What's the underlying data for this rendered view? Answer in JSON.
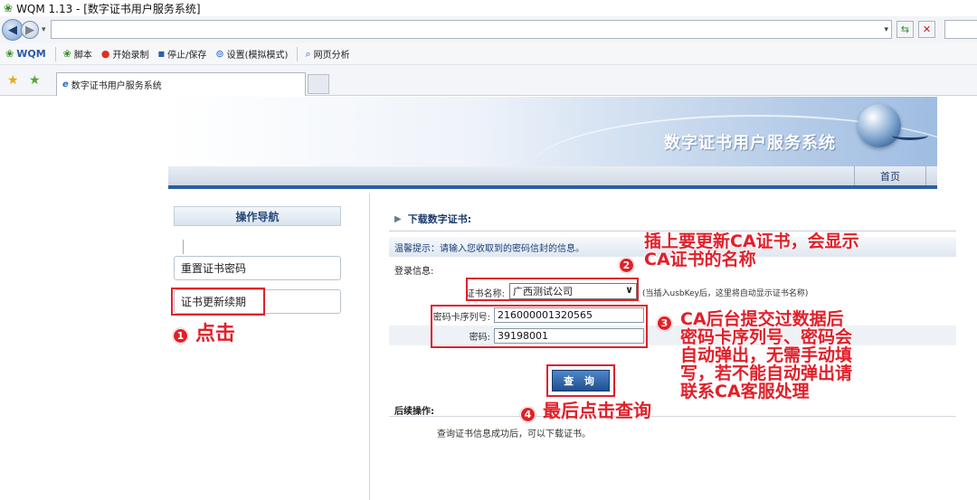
{
  "window": {
    "title": "WQM 1.13 - [数字证书用户服务系统]"
  },
  "toolbar": {
    "brand": "WQM",
    "script": "脚本",
    "record": "开始录制",
    "stop_save": "停止/保存",
    "settings": "设置(模拟模式)",
    "page_analysis": "网页分析"
  },
  "tab": {
    "label": "数字证书用户服务系统"
  },
  "site": {
    "banner_title": "数字证书用户服务系统",
    "nav_home": "首页"
  },
  "sidebar": {
    "heading": "操作导航",
    "items": [
      {
        "label": "重置证书密码"
      },
      {
        "label": "证书更新续期"
      }
    ]
  },
  "main": {
    "section_title": "下载数字证书:",
    "tip": "温馨提示：请输入您收取到的密码信封的信息。",
    "login_info": "登录信息:",
    "cert_name_label": "证书名称:",
    "cert_name_value": "广西测试公司",
    "cert_name_hint": "(当插入usbKey后，这里将自动显示证书名称)",
    "card_serial_label": "密码卡序列号:",
    "card_serial_value": "216000001320565",
    "password_label": "密码:",
    "password_value": "39198001",
    "query_button": "查 询",
    "followup_label": "后续操作:",
    "followup_text": "查询证书信息成功后，可以下载证书。"
  },
  "annotations": {
    "a1": {
      "num": "1",
      "text": "点击"
    },
    "a2": {
      "num": "2",
      "line1": "插上要更新CA证书，会显示",
      "line2": "CA证书的名称"
    },
    "a3": {
      "num": "3",
      "lines": [
        "CA后台提交过数据后",
        "密码卡序列号、密码会",
        "自动弹出，无需手动填",
        "写，若不能自动弹出请",
        "联系CA客服处理"
      ]
    },
    "a4": {
      "num": "4",
      "text": "最后点击查询"
    }
  }
}
